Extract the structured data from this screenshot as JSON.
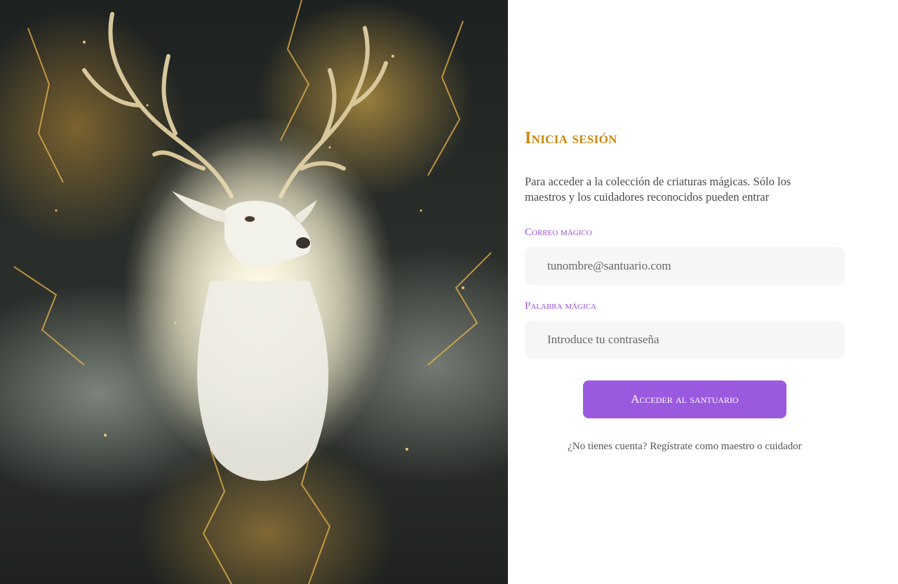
{
  "hero": {
    "image": "white-stag-in-golden-mist"
  },
  "form": {
    "title": "Inicia sesión",
    "description": "Para acceder a la colección de criaturas mágicas. Sólo los maestros y los cuidadores reconocidos pueden entrar",
    "email_label": "Correo mágico",
    "email_placeholder": "tunombre@santuario.com",
    "password_label": "Palabra mágica",
    "password_placeholder": "Introduce tu contraseña",
    "submit_label": "Acceder al santuario",
    "register_text": "¿No tienes cuenta? Regístrate como maestro o cuidador"
  },
  "colors": {
    "title": "#c9860a",
    "label": "#9b4fd8",
    "button": "#9b59e0",
    "field_bg": "#f6f6f6"
  }
}
